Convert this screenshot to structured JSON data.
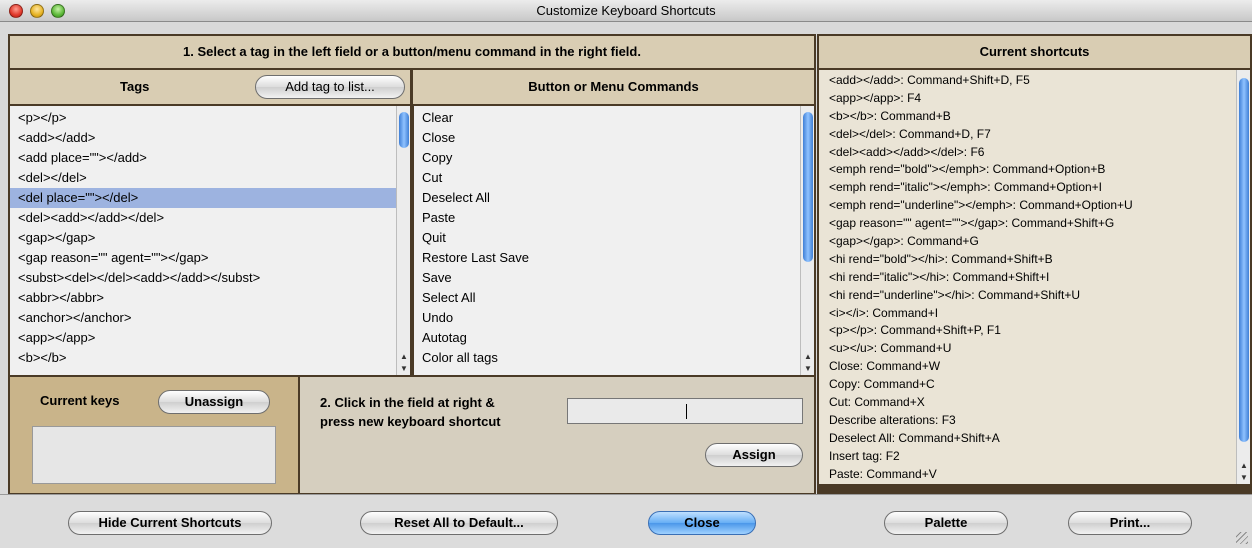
{
  "window": {
    "title": "Customize Keyboard Shortcuts"
  },
  "instructions": {
    "step1": "1. Select a tag in the left field or a button/menu command in the right field.",
    "step2_line1": "2. Click in the field at right &",
    "step2_line2": "press new keyboard shortcut"
  },
  "tags_panel": {
    "title": "Tags",
    "add_button": "Add tag to list...",
    "items": [
      "<p></p>",
      "<add></add>",
      "<add place=\"\"></add>",
      "<del></del>",
      "<del place=\"\"></del>",
      "<del><add></add></del>",
      "<gap></gap>",
      "<gap reason=\"\" agent=\"\"></gap>",
      "<subst><del></del><add></add></subst>",
      "<abbr></abbr>",
      "<anchor></anchor>",
      "<app></app>",
      "<b></b>"
    ],
    "selected_index": 4
  },
  "commands_panel": {
    "title": "Button or Menu Commands",
    "items": [
      "Clear",
      "Close",
      "Copy",
      "Cut",
      "Deselect All",
      "Paste",
      "Quit",
      "Restore Last Save",
      "Save",
      "Select All",
      "Undo",
      "Autotag",
      "Color all tags"
    ]
  },
  "current_keys": {
    "label": "Current keys",
    "unassign_button": "Unassign",
    "assign_button": "Assign",
    "shortcut_value": ""
  },
  "current_shortcuts": {
    "title": "Current shortcuts",
    "items": [
      "<add></add>: Command+Shift+D, F5",
      "<app></app>: F4",
      "<b></b>: Command+B",
      "<del></del>: Command+D, F7",
      "<del><add></add></del>: F6",
      "<emph rend=\"bold\"></emph>: Command+Option+B",
      "<emph rend=\"italic\"></emph>: Command+Option+I",
      "<emph rend=\"underline\"></emph>: Command+Option+U",
      "<gap reason=\"\" agent=\"\"></gap>: Command+Shift+G",
      "<gap></gap>: Command+G",
      "<hi rend=\"bold\"></hi>: Command+Shift+B",
      "<hi rend=\"italic\"></hi>: Command+Shift+I",
      "<hi rend=\"underline\"></hi>: Command+Shift+U",
      "<i></i>: Command+I",
      "<p></p>: Command+Shift+P, F1",
      "<u></u>: Command+U",
      "Close: Command+W",
      "Copy: Command+C",
      "Cut: Command+X",
      "Describe alterations: F3",
      "Deselect All: Command+Shift+A",
      "Insert tag: F2",
      "Paste: Command+V"
    ]
  },
  "bottom_buttons": {
    "hide": "Hide Current Shortcuts",
    "reset": "Reset All to Default...",
    "close": "Close",
    "palette": "Palette",
    "print": "Print..."
  },
  "colors": {
    "panel_border": "#4a3a26",
    "selection": "#9db3e0",
    "accent": "#4b97ea"
  }
}
